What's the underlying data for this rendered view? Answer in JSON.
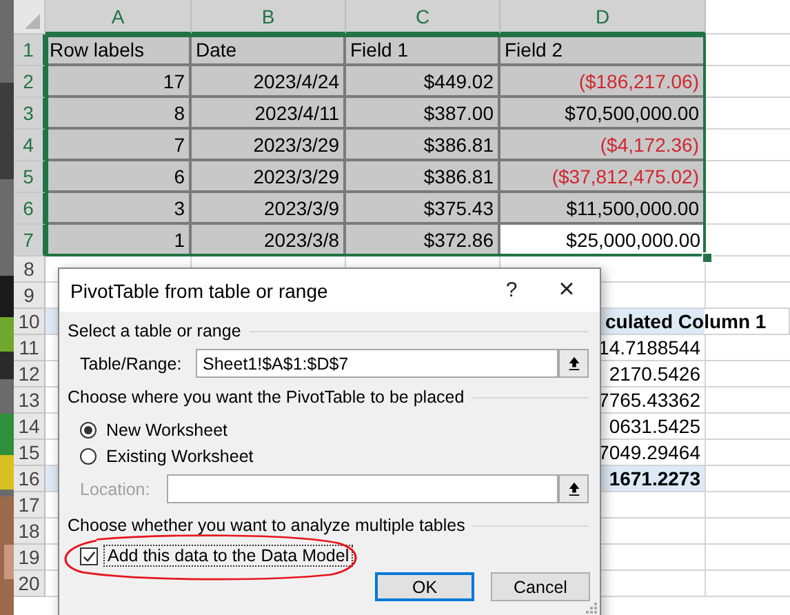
{
  "sheet": {
    "columns": [
      {
        "label": "A",
        "selected": true
      },
      {
        "label": "B",
        "selected": true
      },
      {
        "label": "C",
        "selected": true
      },
      {
        "label": "D",
        "selected": true
      }
    ],
    "rows": [
      {
        "number": "1",
        "selected": true,
        "kind": "table_header",
        "cells": [
          "Row labels",
          "Date",
          "Field 1",
          "Field 2"
        ]
      },
      {
        "number": "2",
        "selected": true,
        "kind": "table_row",
        "cells": [
          "17",
          "2023/4/24",
          "$449.02",
          "($186,217.06)"
        ],
        "color": "#d0262e",
        "active": false
      },
      {
        "number": "3",
        "selected": true,
        "kind": "table_row",
        "cells": [
          "8",
          "2023/4/11",
          "$387.00",
          "$70,500,000.00"
        ],
        "color": "#000000",
        "active": false
      },
      {
        "number": "4",
        "selected": true,
        "kind": "table_row",
        "cells": [
          "7",
          "2023/3/29",
          "$386.81",
          "($4,172.36)"
        ],
        "color": "#d0262e",
        "active": false
      },
      {
        "number": "5",
        "selected": true,
        "kind": "table_row",
        "cells": [
          "6",
          "2023/3/29",
          "$386.81",
          "($37,812,475.02)"
        ],
        "color": "#d0262e",
        "active": false
      },
      {
        "number": "6",
        "selected": true,
        "kind": "table_row",
        "cells": [
          "3",
          "2023/3/9",
          "$375.43",
          "$11,500,000.00"
        ],
        "color": "#000000",
        "active": false
      },
      {
        "number": "7",
        "selected": true,
        "kind": "table_row",
        "cells": [
          "1",
          "2023/3/8",
          "$372.86",
          "$25,000,000.00"
        ],
        "color": "#000000",
        "active": true
      },
      {
        "number": "8",
        "selected": false,
        "kind": "empty"
      },
      {
        "number": "9",
        "selected": false,
        "kind": "empty"
      },
      {
        "number": "10",
        "selected": false,
        "kind": "pivot_header",
        "cells": [
          "culated Column 1"
        ]
      },
      {
        "number": "11",
        "selected": false,
        "kind": "pivot_value",
        "cells": [
          "14.7188544"
        ]
      },
      {
        "number": "12",
        "selected": false,
        "kind": "pivot_value",
        "cells": [
          "2170.5426"
        ]
      },
      {
        "number": "13",
        "selected": false,
        "kind": "pivot_value",
        "cells": [
          "7765.43362"
        ]
      },
      {
        "number": "14",
        "selected": false,
        "kind": "pivot_value",
        "cells": [
          "0631.5425"
        ]
      },
      {
        "number": "15",
        "selected": false,
        "kind": "pivot_value",
        "cells": [
          "7049.29464"
        ]
      },
      {
        "number": "16",
        "selected": false,
        "kind": "pivot_total",
        "cells": [
          "1671.2273"
        ]
      },
      {
        "number": "17",
        "selected": false,
        "kind": "empty"
      },
      {
        "number": "18",
        "selected": false,
        "kind": "empty"
      },
      {
        "number": "19",
        "selected": false,
        "kind": "empty"
      },
      {
        "number": "20",
        "selected": false,
        "kind": "empty"
      }
    ]
  },
  "dialog": {
    "title": "PivotTable from table or range",
    "help": "?",
    "close": "×",
    "source_section": "Select a table or range",
    "range_label": "Table/Range:",
    "range_value": "Sheet1!$A$1:$D$7",
    "placement_section": "Choose where you want the PivotTable to be placed",
    "placement_options": [
      {
        "label": "New Worksheet",
        "selected": true
      },
      {
        "label": "Existing Worksheet",
        "selected": false
      }
    ],
    "location_label": "Location:",
    "location_disabled": true,
    "tables_section": "Choose whether you want to analyze multiple tables",
    "data_model": {
      "label": "Add this data to the Data Model",
      "checked": true
    },
    "buttons": [
      {
        "label": "OK",
        "default": true
      },
      {
        "label": "Cancel",
        "default": false
      }
    ]
  }
}
